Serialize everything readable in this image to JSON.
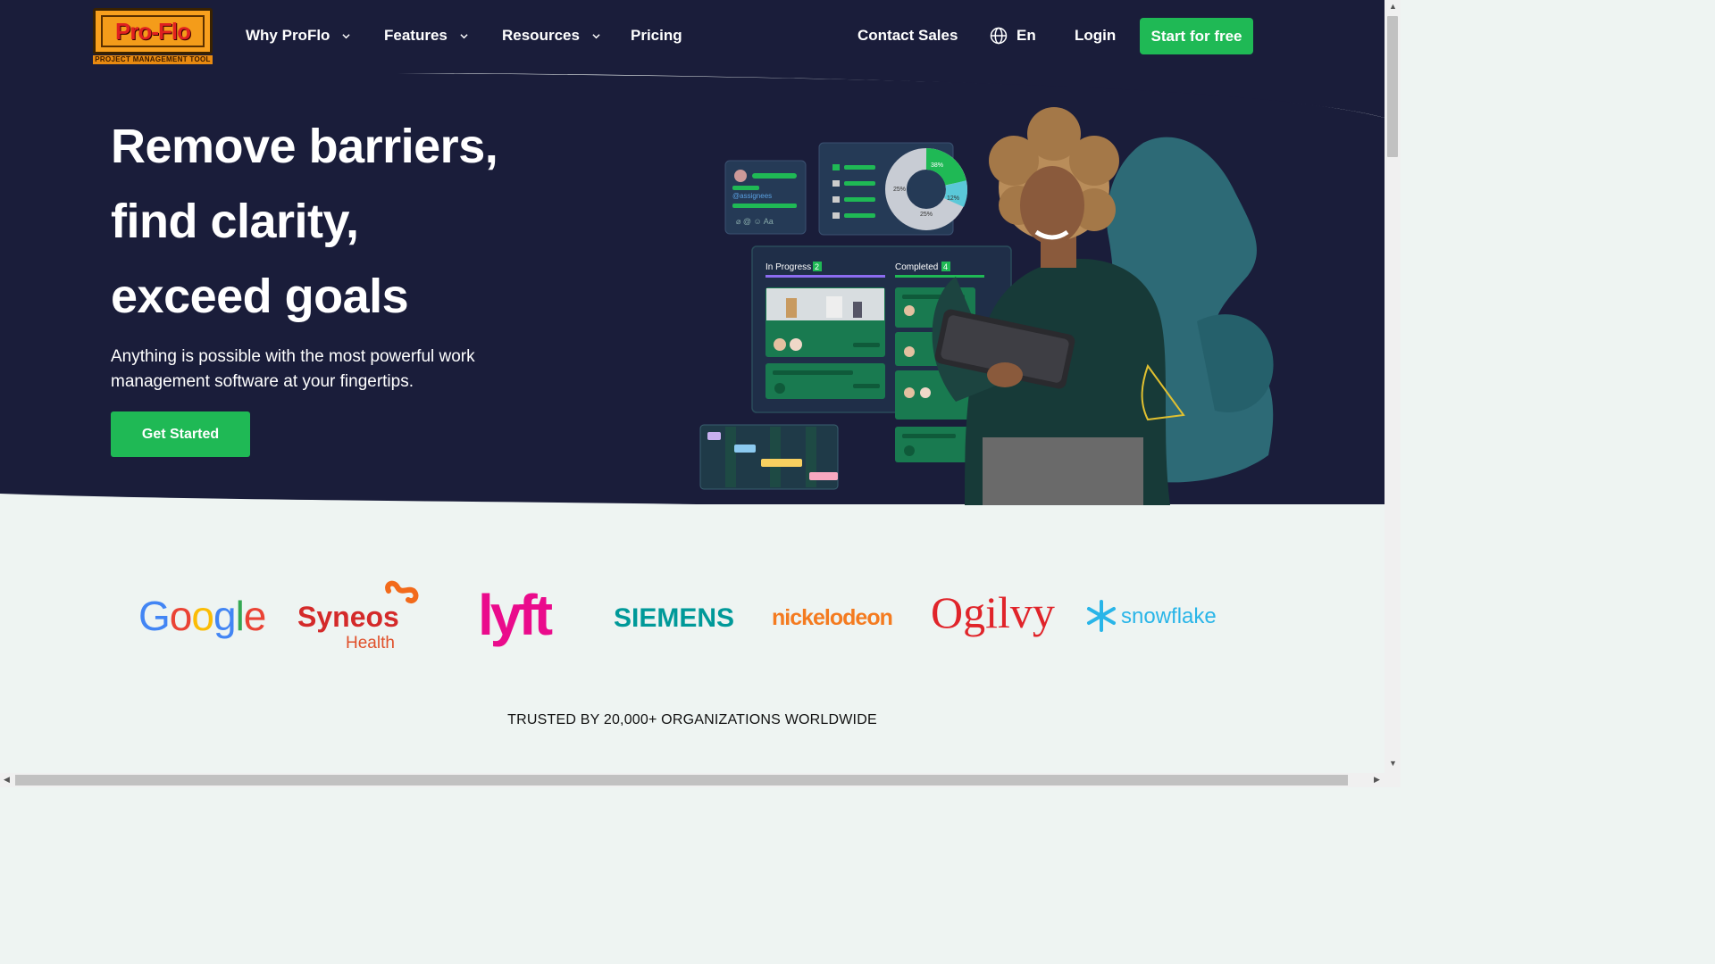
{
  "brand": {
    "logo_text": "Pro-Flo",
    "logo_tagline": "PROJECT MANAGEMENT TOOL"
  },
  "nav": {
    "items": [
      {
        "label": "Why ProFlo",
        "has_dropdown": true
      },
      {
        "label": "Features",
        "has_dropdown": true
      },
      {
        "label": "Resources",
        "has_dropdown": true
      },
      {
        "label": "Pricing",
        "has_dropdown": false
      }
    ],
    "contact_sales": "Contact Sales",
    "language": "En",
    "login": "Login",
    "cta": "Start for free"
  },
  "hero": {
    "title_lines": [
      "Remove barriers,",
      "find clarity,",
      "exceed goals"
    ],
    "subtitle": "Anything is possible with the most powerful work management software at your fingertips.",
    "cta": "Get Started",
    "illustration": {
      "assignees_label": "@assignees",
      "assignees_icons": "⌀ @ ☺ Aa",
      "donut_labels": [
        "38%",
        "25%",
        "12%",
        "25%"
      ],
      "columns": [
        {
          "name": "In Progress",
          "count": "2"
        },
        {
          "name": "Completed",
          "count": "4"
        }
      ]
    }
  },
  "logos": {
    "items": [
      "Google",
      "Syneos Health",
      "lyft",
      "SIEMENS",
      "nickelodeon",
      "Ogilvy",
      "snowflake"
    ],
    "trusted_text": "TRUSTED BY 20,000+ ORGANIZATIONS WORLDWIDE"
  },
  "colors": {
    "navy": "#1a1d3a",
    "green": "#1fb955",
    "page_bg": "#eef4f2"
  }
}
